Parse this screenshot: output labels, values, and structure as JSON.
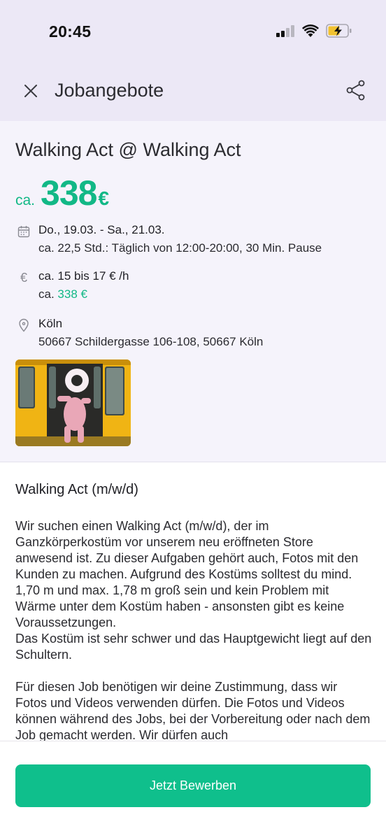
{
  "status_bar": {
    "time": "20:45"
  },
  "nav": {
    "title": "Jobangebote"
  },
  "job": {
    "title": "Walking Act @ Walking Act",
    "price_prefix": "ca.",
    "price_value": "338",
    "price_currency": "€",
    "date_line": "Do., 19.03. - Sa., 21.03.",
    "hours_line": "ca. 22,5 Std.: Täglich von 12:00-20:00, 30 Min. Pause",
    "rate_line": "ca. 15 bis 17 € /h",
    "total_prefix": "ca.",
    "total_value": "338 €",
    "city": "Köln",
    "address": "50667 Schildergasse 106-108, 50667 Köln"
  },
  "description": {
    "heading": "Walking Act (m/w/d)",
    "paragraph1": "Wir suchen einen Walking Act (m/w/d), der im Ganzkörperkostüm vor unserem neu eröffneten Store anwesend ist. Zu dieser Aufgaben gehört auch, Fotos mit den Kunden zu machen. Aufgrund des Kostüms solltest du mind. 1,70 m und max. 1,78 m groß sein und kein Problem mit Wärme unter dem Kostüm haben - ansonsten gibt es keine Voraussetzungen.",
    "paragraph1b": "Das Kostüm ist sehr schwer und das Hauptgewicht liegt auf den Schultern.",
    "paragraph2": "Für diesen Job benötigen wir deine Zustimmung, dass wir Fotos und Videos verwenden dürfen. Die Fotos und Videos können während des Jobs, bei der Vorbereitung oder nach dem Job gemacht werden. Wir dürfen auch"
  },
  "footer": {
    "apply_label": "Jetzt Bewerben"
  },
  "colors": {
    "accent": "#12b886",
    "button": "#0fbf8c",
    "link": "#3a1fa8",
    "header_bg": "#ece8f6"
  },
  "icons": [
    "close-icon",
    "share-icon",
    "calendar-icon",
    "euro-icon",
    "location-pin-icon"
  ]
}
